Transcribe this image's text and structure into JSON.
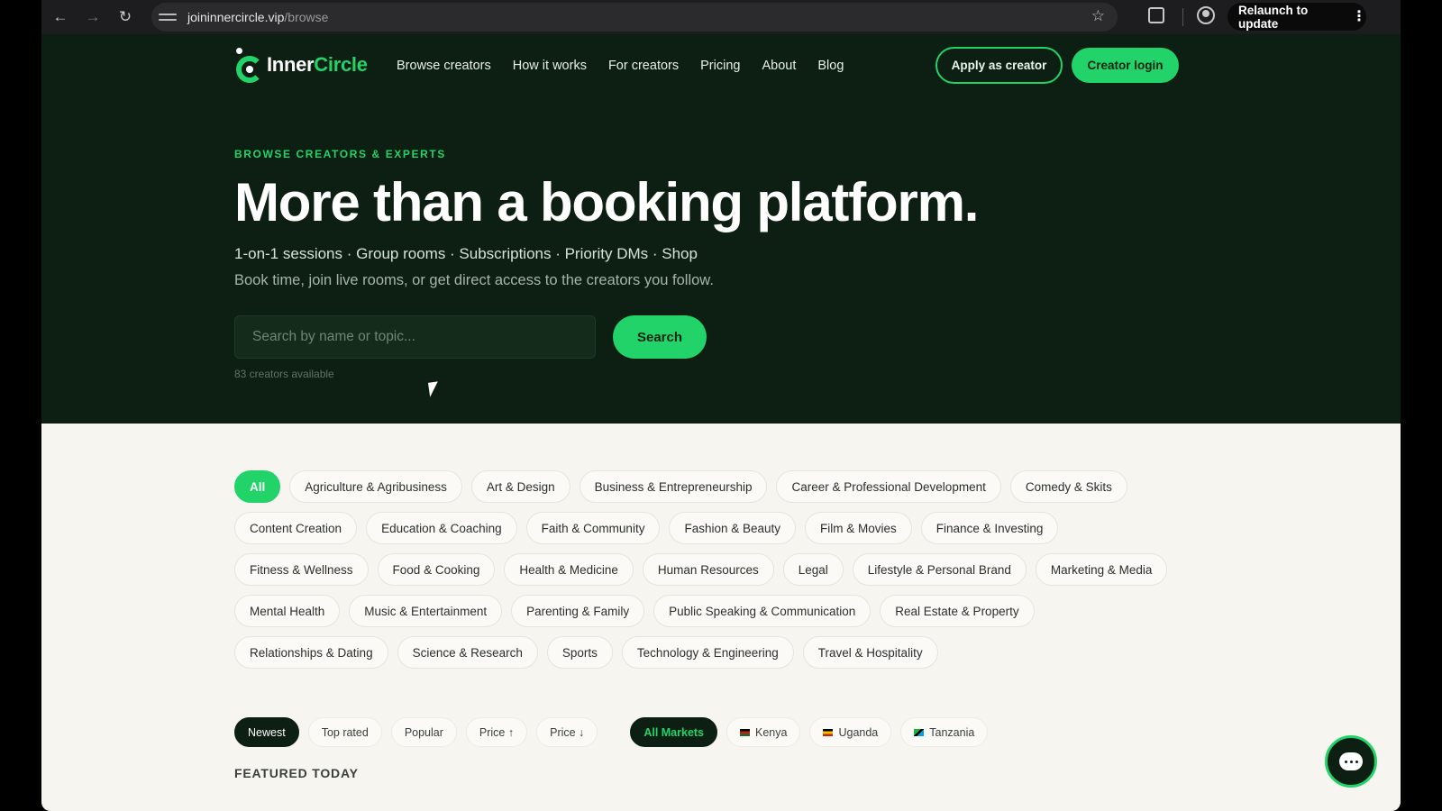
{
  "browser": {
    "url_host": "joininnercircle.vip",
    "url_path": "/browse",
    "relaunch_label": "Relaunch to update",
    "back_icon": "←",
    "forward_icon": "→",
    "reload_icon": "↻",
    "star_icon": "☆",
    "kebab_icon": "⋮"
  },
  "header": {
    "logo_prefix": "Inner",
    "logo_suffix": "Circle",
    "nav": [
      "Browse creators",
      "How it works",
      "For creators",
      "Pricing",
      "About",
      "Blog"
    ],
    "apply_label": "Apply as creator",
    "login_label": "Creator login"
  },
  "hero": {
    "eyebrow": "BROWSE CREATORS & EXPERTS",
    "title": "More than a booking platform.",
    "features": "1-on-1 sessions · Group rooms · Subscriptions · Priority DMs · Shop",
    "subtitle": "Book time, join live rooms, or get direct access to the creators you follow.",
    "search_placeholder": "Search by name or topic...",
    "search_label": "Search",
    "creator_count": "83 creators available"
  },
  "categories": {
    "rows": [
      [
        "All",
        "Agriculture & Agribusiness",
        "Art & Design",
        "Business & Entrepreneurship",
        "Career & Professional Development",
        "Comedy & Skits"
      ],
      [
        "Content Creation",
        "Education & Coaching",
        "Faith & Community",
        "Fashion & Beauty",
        "Film & Movies",
        "Finance & Investing"
      ],
      [
        "Fitness & Wellness",
        "Food & Cooking",
        "Health & Medicine",
        "Human Resources",
        "Legal",
        "Lifestyle & Personal Brand",
        "Marketing & Media"
      ],
      [
        "Mental Health",
        "Music & Entertainment",
        "Parenting & Family",
        "Public Speaking & Communication",
        "Real Estate & Property"
      ],
      [
        "Relationships & Dating",
        "Science & Research",
        "Sports",
        "Technology & Engineering",
        "Travel & Hospitality"
      ]
    ],
    "active": "All"
  },
  "sort": {
    "options": [
      "Newest",
      "Top rated",
      "Popular",
      "Price ↑",
      "Price ↓"
    ],
    "active": "Newest"
  },
  "markets": {
    "all_label": "All Markets",
    "countries": [
      {
        "name": "Kenya",
        "flag": "ke"
      },
      {
        "name": "Uganda",
        "flag": "ug"
      },
      {
        "name": "Tanzania",
        "flag": "tz"
      }
    ]
  },
  "featured_heading": "FEATURED TODAY",
  "colors": {
    "accent": "#22d36a",
    "dark_bg": "#0d1f13",
    "light_bg": "#f6f5f0"
  }
}
